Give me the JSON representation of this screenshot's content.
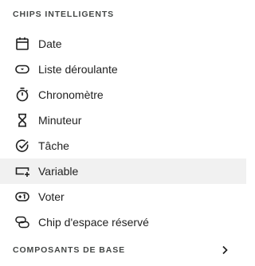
{
  "smart_chips": {
    "header": "CHIPS INTELLIGENTS",
    "items": [
      {
        "label": "Date",
        "icon": "calendar-icon"
      },
      {
        "label": "Liste déroulante",
        "icon": "dropdown-icon"
      },
      {
        "label": "Chronomètre",
        "icon": "stopwatch-icon"
      },
      {
        "label": "Minuteur",
        "icon": "hourglass-icon"
      },
      {
        "label": "Tâche",
        "icon": "task-check-icon"
      },
      {
        "label": "Variable",
        "icon": "variable-icon"
      },
      {
        "label": "Voter",
        "icon": "vote-icon"
      },
      {
        "label": "Chip d'espace réservé",
        "icon": "placeholder-chip-icon"
      }
    ]
  },
  "base_components": {
    "header": "COMPOSANTS DE BASE",
    "icon": "chevron-right-icon"
  },
  "colors": {
    "text": "#1f1f1f",
    "header_text": "#444746",
    "hover_background": "#f1f1f1"
  }
}
